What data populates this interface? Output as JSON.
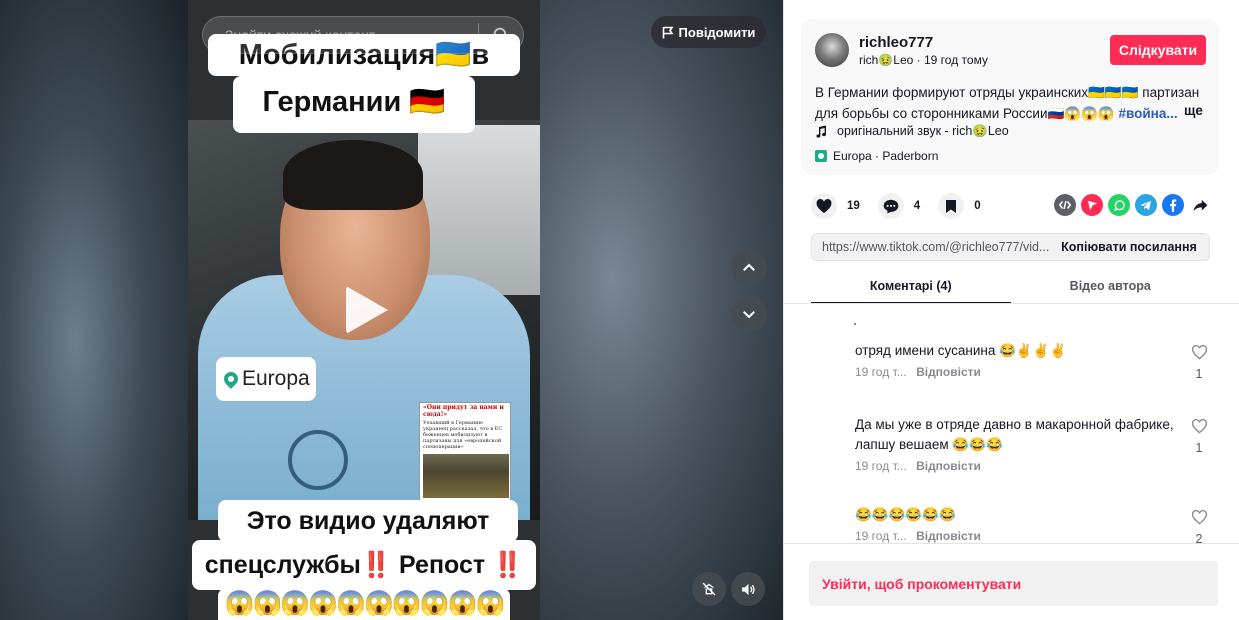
{
  "search": {
    "placeholder": "Знайти схожий контент"
  },
  "report_label": "Повідомити",
  "video": {
    "caption_line1": "Мобилизация🇺🇦в",
    "caption_line2": "Германии 🇩🇪",
    "location": "Europa",
    "caption_line3": "Это видио удаляют",
    "caption_line4": "спецслужбы‼️ Репост ‼️ 😱",
    "caption_line5": "😱😱😱😱😱😱😱😱😱😱",
    "news_title": "«Они придут за нами и сюда!»",
    "news_body": "Уехавший в Германию украинец рассказал, что в ЕС беженцев мобилизуют в партизаны для «европейской спецоперации»"
  },
  "author": {
    "username": "richleo777",
    "display_name": "rich🤢Leo",
    "posted": "19 год тому",
    "follow_label": "Слідкувати"
  },
  "description": {
    "text": "В Германии формируют отряды украинских🇺🇦🇺🇦🇺🇦 партизан для борьбы со сторонниками России🇷🇺😱😱😱",
    "hashtag": "#война...",
    "more": "ще"
  },
  "music": "оригінальний звук - rich🤢Leo",
  "location_chip": "Europa · Paderborn",
  "stats": {
    "likes": "19",
    "comments": "4",
    "saves": "0"
  },
  "link": {
    "url": "https://www.tiktok.com/@richleo777/vid...",
    "copy_label": "Копіювати посилання"
  },
  "tabs": [
    {
      "label": "Коментарі (4)"
    },
    {
      "label": "Відео автора"
    }
  ],
  "comments": [
    {
      "text": "отряд имени сусанина 😂✌️✌️✌️",
      "time": "19 год т...",
      "reply": "Відповісти",
      "likes": "1"
    },
    {
      "text": "Да мы уже в отряде давно в макаронной фабрике, лапшу вешаем 😂😂😂",
      "time": "19 год т...",
      "reply": "Відповісти",
      "likes": "1"
    },
    {
      "text": "😂😂😂😂😂😂",
      "time": "19 год т...",
      "reply": "Відповісти",
      "likes": "2"
    }
  ],
  "login_prompt": "Увійти, щоб прокоментувати",
  "colors": {
    "accent": "#fe2c55",
    "hashtag": "#2b5db9",
    "location": "#20a985"
  }
}
